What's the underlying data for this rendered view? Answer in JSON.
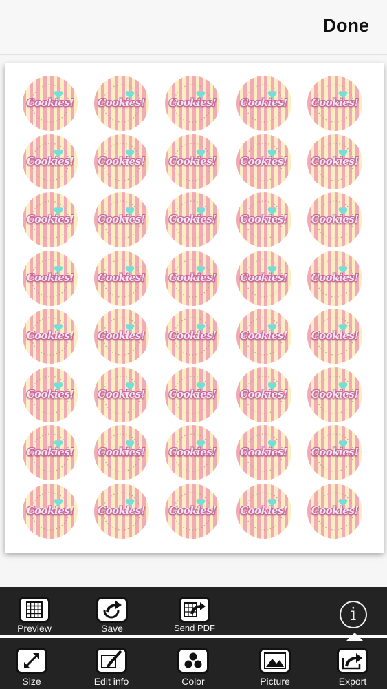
{
  "header": {
    "done_label": "Done"
  },
  "sheet": {
    "rows": 8,
    "cols": 5,
    "sticker_text": "Cookies!"
  },
  "colors": {
    "pink": "#f2aab4",
    "cream": "#fbeec2",
    "heart": "#72e0d8",
    "bar": "#232323"
  },
  "toolbar_top": [
    {
      "label": "Preview",
      "icon": "grid-icon"
    },
    {
      "label": "Save",
      "icon": "share-arrow-icon"
    },
    {
      "label": "Send PDF",
      "icon": "send-pdf-icon"
    }
  ],
  "toolbar_bottom": [
    {
      "label": "Size",
      "icon": "resize-icon"
    },
    {
      "label": "Edit info",
      "icon": "pencil-icon"
    },
    {
      "label": "Color",
      "icon": "palette-icon"
    },
    {
      "label": "Picture",
      "icon": "picture-icon"
    },
    {
      "label": "Export",
      "icon": "export-icon"
    }
  ],
  "info_label": "i"
}
